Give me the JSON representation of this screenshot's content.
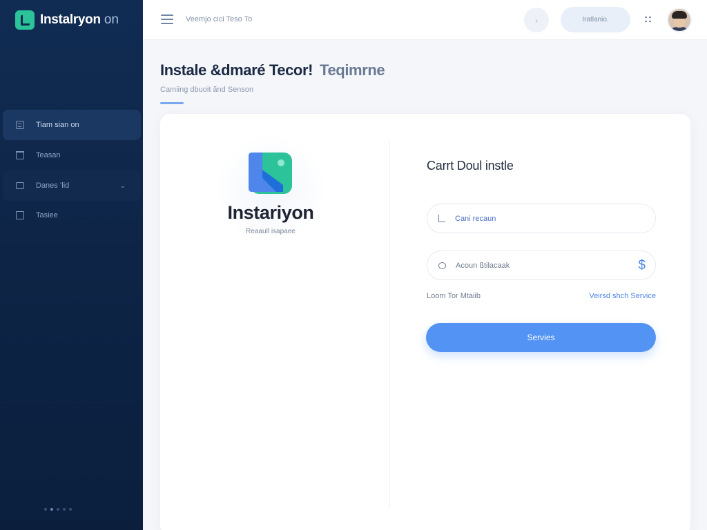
{
  "brand": {
    "name": "Instalryon",
    "suffix": "on"
  },
  "sidebar": {
    "items": [
      {
        "label": "Tiam sian on",
        "icon": "list-icon",
        "active": true
      },
      {
        "label": "Teasan",
        "icon": "trash-icon",
        "active": false
      },
      {
        "label": "Danes ‘lid",
        "icon": "wallet-icon",
        "active": false,
        "expandable": true
      },
      {
        "label": "Tasiee",
        "icon": "box-icon",
        "active": false
      }
    ]
  },
  "topbar": {
    "breadcrumb": "Veemjo cici Teso To",
    "circle_button_label": "›",
    "pill_button_label": "Iratlanio.",
    "menu_icon": "hamburger-icon",
    "grid_icon": "grid-icon"
  },
  "page": {
    "title": "Instale &dmaré Tecor!",
    "title_muted": "Teqimrne",
    "subtitle": "Camiing dbuoit ãnd Senson"
  },
  "logo": {
    "name": "Instariyon",
    "tagline": "Reaaull isapaee"
  },
  "form": {
    "title": "Carrt Doul instle",
    "field1": {
      "value": "Cani recaun",
      "icon": "user-icon"
    },
    "field2": {
      "value": "Acoun ßtilacaak",
      "icon": "lock-icon",
      "trailing": "$"
    },
    "link_left": "Loom Tor Mtaiib",
    "link_right": "Veirsd shch Service",
    "submit_label": "Servies"
  },
  "colors": {
    "sidebar": "#0d2446",
    "accent": "#5393f3",
    "brand": "#2cc29a"
  }
}
